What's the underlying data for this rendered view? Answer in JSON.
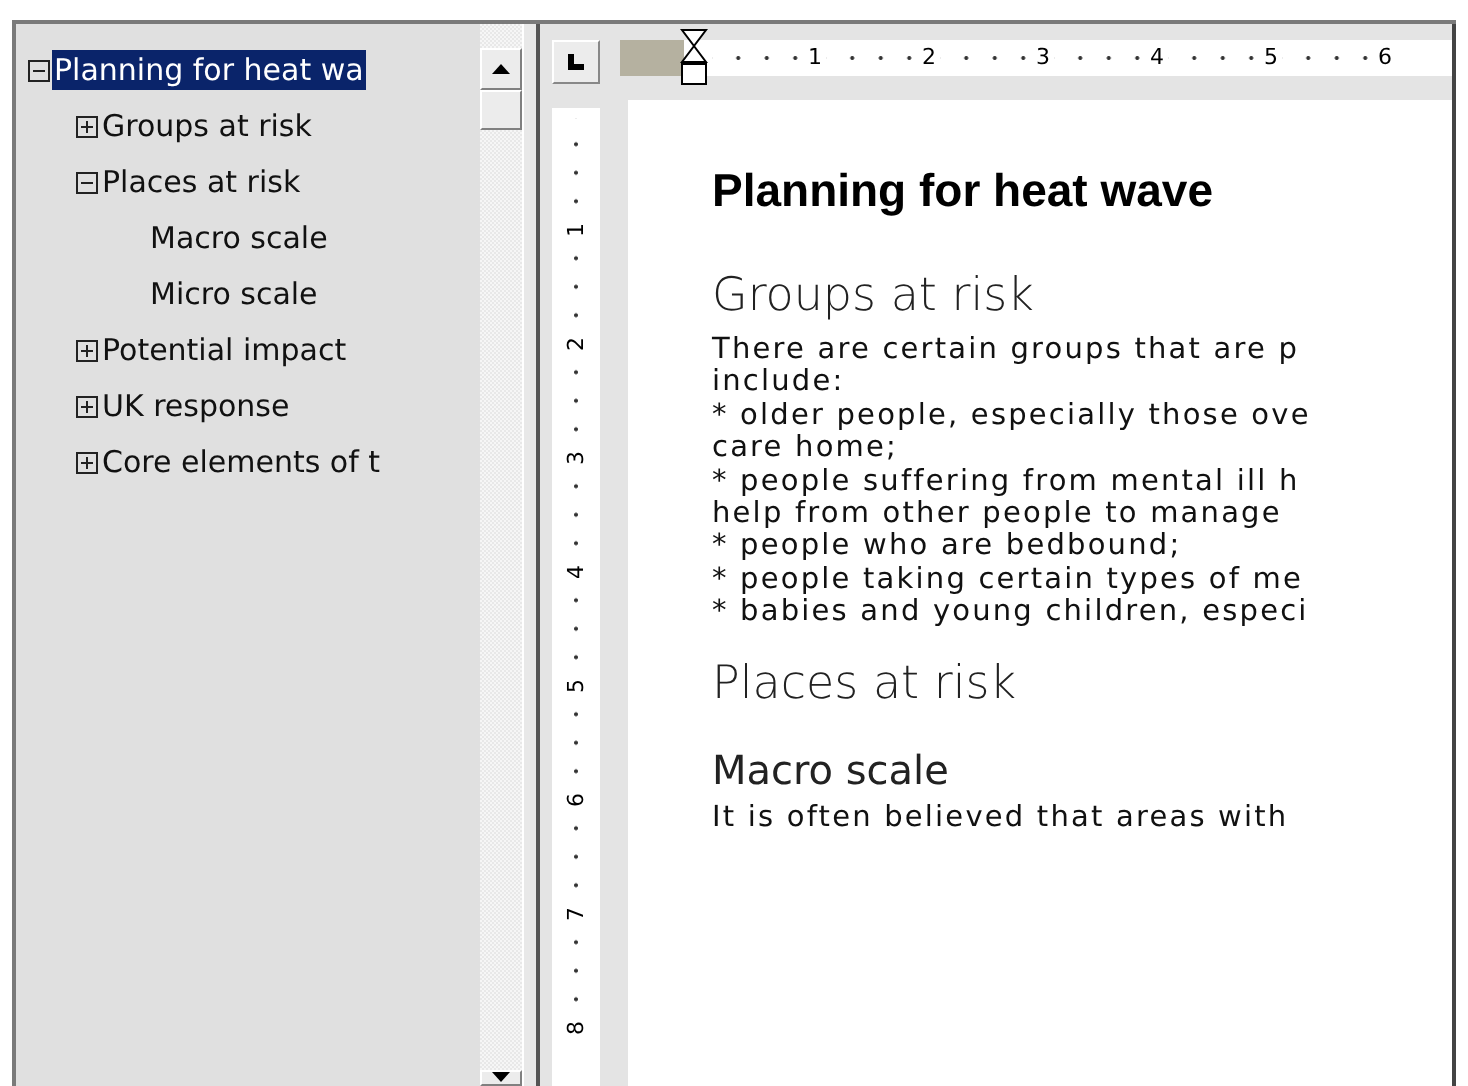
{
  "outline": {
    "items": [
      {
        "label": "Planning for heat wa",
        "expanded": true,
        "selected": true,
        "children": [
          {
            "label": "Groups at risk",
            "expanded": false,
            "selected": false
          },
          {
            "label": "Places at risk",
            "expanded": true,
            "selected": false,
            "children": [
              {
                "label": "Macro scale",
                "selected": false
              },
              {
                "label": "Micro scale",
                "selected": false
              }
            ]
          },
          {
            "label": "Potential impact",
            "expanded": false,
            "selected": false
          },
          {
            "label": "UK response",
            "expanded": false,
            "selected": false
          },
          {
            "label": "Core elements of t",
            "expanded": false,
            "selected": false
          }
        ]
      }
    ]
  },
  "ruler": {
    "horizontal_marks": [
      "1",
      "2",
      "3",
      "4",
      "5",
      "6"
    ],
    "vertical_marks": [
      "1",
      "2",
      "3",
      "4",
      "5",
      "6",
      "7",
      "8"
    ]
  },
  "document": {
    "blocks": [
      {
        "kind": "title",
        "text": "Planning for heat wave"
      },
      {
        "kind": "heading",
        "text": "Groups at risk"
      },
      {
        "kind": "paragraph",
        "lines": [
          "There are certain groups that are p",
          "include:",
          "* older people, especially those ove",
          "care home;",
          "* people suffering from mental ill h",
          "help from other people to manage",
          "* people who are bedbound;",
          "* people taking certain types of me",
          "* babies and young children, especi"
        ]
      },
      {
        "kind": "heading",
        "text": "Places at risk"
      },
      {
        "kind": "subheading",
        "text": "Macro scale"
      },
      {
        "kind": "paragraph",
        "lines": [
          "It is often believed that areas with"
        ]
      }
    ]
  }
}
